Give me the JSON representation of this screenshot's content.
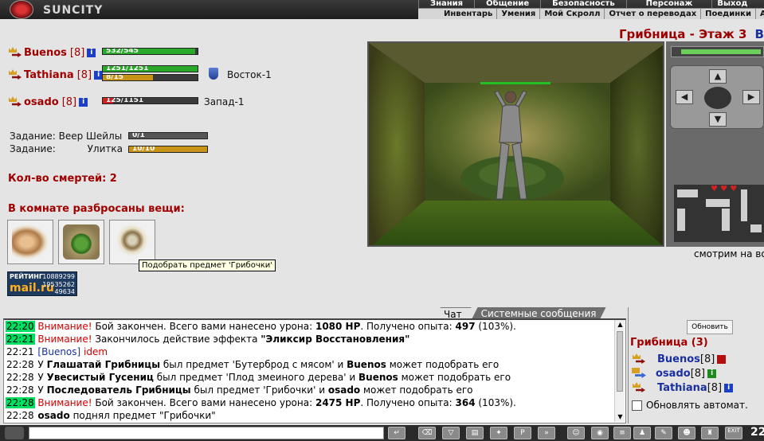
{
  "game": {
    "title": "SUNCITY"
  },
  "menu": {
    "top": [
      "Знания",
      "Общение",
      "Безопасность",
      "Персонаж",
      "Выход"
    ],
    "bottom": [
      "Инвентарь",
      "Умения",
      "Мой Скролл",
      "Отчет о переводах",
      "Поединки",
      "А"
    ]
  },
  "party": [
    {
      "name": "Buenos",
      "level": "[8]",
      "hp": "532/545",
      "hp_fraction": 0.976,
      "location": ""
    },
    {
      "name": "Tathiana",
      "level": "[8]",
      "hp": "1251/1251",
      "hp_fraction": 1.0,
      "mana": "8/15",
      "mana_fraction": 0.53,
      "location": "Восток-1"
    },
    {
      "name": "osado",
      "level": "[8]",
      "hp": "125/1151",
      "hp_fraction": 0.11,
      "location": "Запад-1"
    }
  ],
  "tasks": [
    {
      "label": "Задание:",
      "name": "Веер Шейлы",
      "progress": "0/1",
      "fraction": 0.0
    },
    {
      "label": "Задание:",
      "name": "Улитка",
      "progress": "10/10",
      "fraction": 1.0
    }
  ],
  "deaths": "Кол-во смертей: 2",
  "items_heading": "В комнате разбросаны вещи:",
  "items": [
    {
      "name": "sandwich-item"
    },
    {
      "name": "fruit-item"
    },
    {
      "name": "mushrooms-item"
    }
  ],
  "tooltip": "Подобрать предмет 'Грибочки'",
  "counter": {
    "label": "РЕЙТИНГ",
    "brand": "mail.ru",
    "n1": "10889299",
    "n2": "19535262",
    "n3": "49634"
  },
  "location": {
    "name": "Грибница - Этаж 3",
    "exit": "Вы"
  },
  "look": "смотрим на во",
  "chat": {
    "tabs": [
      "Чат",
      "Системные сообщения"
    ],
    "messages": [
      {
        "time": "22:20",
        "hl": true,
        "parts": [
          {
            "t": "Внимание!",
            "c": "red"
          },
          {
            "t": " Бой закончен. Всего вами нанесено урона: "
          },
          {
            "t": "1080 HP",
            "c": "b"
          },
          {
            "t": ". Получено опыта: "
          },
          {
            "t": "497",
            "c": "b"
          },
          {
            "t": " (103%)."
          }
        ]
      },
      {
        "time": "22:21",
        "hl": true,
        "parts": [
          {
            "t": "Внимание!",
            "c": "red"
          },
          {
            "t": " Закончилось действие эффекта "
          },
          {
            "t": "\"Эликсир Восстановления\"",
            "c": "b"
          }
        ]
      },
      {
        "time": "22:21",
        "hl": false,
        "parts": [
          {
            "t": "[Buenos]",
            "c": "blue"
          },
          {
            "t": " "
          },
          {
            "t": "idem",
            "c": "red"
          }
        ]
      },
      {
        "time": "22:28",
        "hl": false,
        "parts": [
          {
            "t": "У "
          },
          {
            "t": "Глашатай Грибницы",
            "c": "b"
          },
          {
            "t": " был предмет 'Бутерброд с мясом' и "
          },
          {
            "t": "Buenos",
            "c": "b"
          },
          {
            "t": " может подобрать его"
          }
        ]
      },
      {
        "time": "22:28",
        "hl": false,
        "parts": [
          {
            "t": "У "
          },
          {
            "t": "Увесистый Гусениц",
            "c": "b"
          },
          {
            "t": " был предмет 'Плод змеиного дерева' и "
          },
          {
            "t": "Buenos",
            "c": "b"
          },
          {
            "t": " может подобрать его"
          }
        ]
      },
      {
        "time": "22:28",
        "hl": false,
        "parts": [
          {
            "t": "У "
          },
          {
            "t": "Последователь Грибницы",
            "c": "b"
          },
          {
            "t": " был предмет 'Грибочки' и "
          },
          {
            "t": "osado",
            "c": "b"
          },
          {
            "t": " может подобрать его"
          }
        ]
      },
      {
        "time": "22:28",
        "hl": true,
        "parts": [
          {
            "t": "Внимание!",
            "c": "red"
          },
          {
            "t": " Бой закончен. Всего вами нанесено урона: "
          },
          {
            "t": "2475 HP",
            "c": "b"
          },
          {
            "t": ". Получено опыта: "
          },
          {
            "t": "364",
            "c": "b"
          },
          {
            "t": " (103%)."
          }
        ]
      },
      {
        "time": "22:28",
        "hl": false,
        "parts": [
          {
            "t": "osado",
            "c": "b"
          },
          {
            "t": " поднял предмет \"Грибочки\""
          }
        ]
      }
    ]
  },
  "room_players": {
    "refresh_label": "Обновить",
    "count_label": "Грибница (3)",
    "players": [
      {
        "name": "Buenos",
        "level": "[8]",
        "badge": "red"
      },
      {
        "name": "osado",
        "level": "[8]",
        "badge": "green"
      },
      {
        "name": "Tathiana",
        "level": "[8]",
        "badge": "blue"
      }
    ],
    "auto_refresh_label": "Обновлять автомат."
  },
  "toolbar": {
    "exit_label": "EXIT",
    "clock": "22"
  }
}
